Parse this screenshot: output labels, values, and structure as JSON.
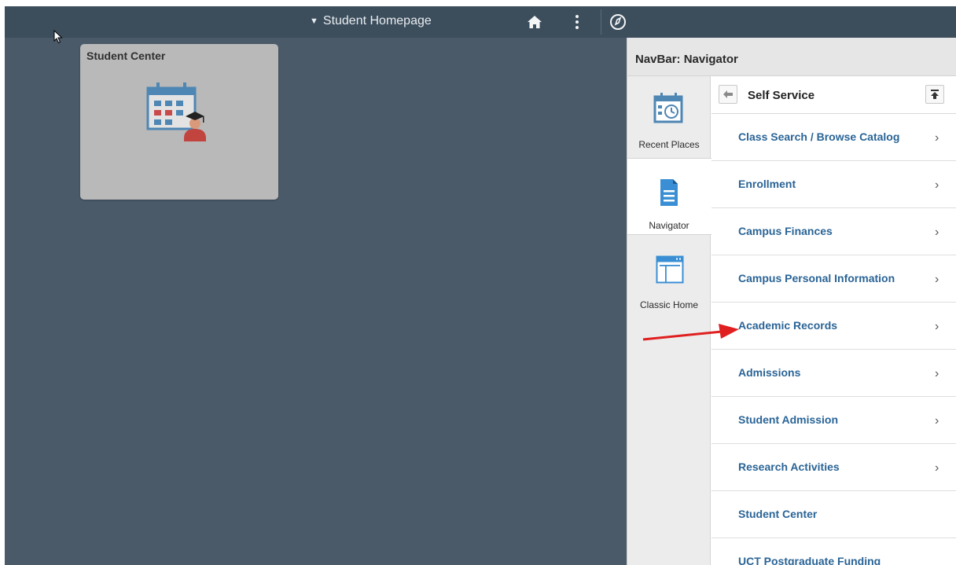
{
  "header": {
    "homepage_title": "Student Homepage"
  },
  "tile": {
    "title": "Student Center"
  },
  "navbar": {
    "title": "NavBar: Navigator",
    "side_items": [
      {
        "label": "Recent Places"
      },
      {
        "label": "Navigator"
      },
      {
        "label": "Classic Home"
      }
    ],
    "section_title": "Self Service",
    "items": [
      {
        "label": "Class Search / Browse Catalog",
        "has_children": true
      },
      {
        "label": "Enrollment",
        "has_children": true
      },
      {
        "label": "Campus Finances",
        "has_children": true
      },
      {
        "label": "Campus Personal Information",
        "has_children": true
      },
      {
        "label": "Academic Records",
        "has_children": true
      },
      {
        "label": "Admissions",
        "has_children": true
      },
      {
        "label": "Student Admission",
        "has_children": true
      },
      {
        "label": "Research Activities",
        "has_children": true
      },
      {
        "label": "Student Center",
        "has_children": false
      },
      {
        "label": "UCT Postgraduate Funding",
        "has_children": false
      }
    ],
    "chevron": "›"
  },
  "colors": {
    "accent_link": "#2a6496",
    "background": "#4a5a69",
    "annotation_arrow": "#e02020"
  },
  "icons": {
    "header": [
      "home-icon",
      "more-options-icon",
      "navbar-compass-icon"
    ],
    "side": [
      "recent-places-icon",
      "navigator-icon",
      "classic-home-icon"
    ]
  }
}
